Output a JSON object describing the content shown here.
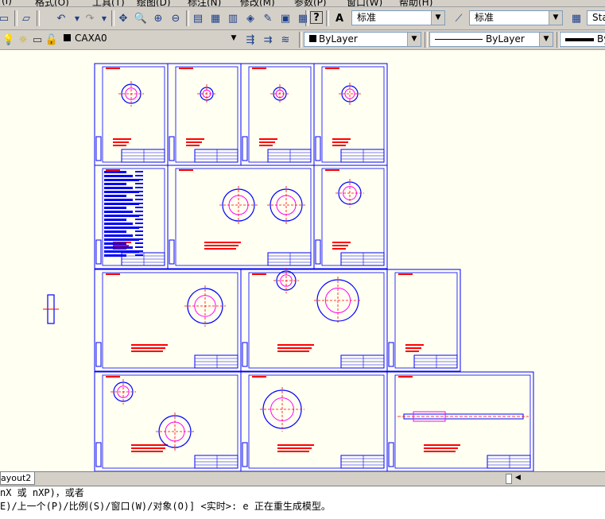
{
  "menubar": {
    "items": [
      "(I)",
      "格式(O)",
      "工具(T)",
      "绘图(D)",
      "标注(N)",
      "修改(M)",
      "参数(P)",
      "窗口(W)",
      "帮助(H)"
    ]
  },
  "toolbar1": {
    "text_style": "标准",
    "dim_style": "标准",
    "table_style": "Sta"
  },
  "toolbar2": {
    "layer": "CAXA0",
    "color": "ByLayer",
    "linetype": "ByLayer",
    "lineweight": "By"
  },
  "tabs": {
    "layout2": "ayout2"
  },
  "command": {
    "line1": "nX 或 nXP)，或者",
    "line2": "E)/上一个(P)/比例(S)/窗口(W)/对象(O)] <实时>: e 正在重生成模型。"
  },
  "colors": {
    "canvas_bg": "#fffff2",
    "sheet_border": "#0000ff",
    "red": "#ff0000",
    "blue": "#0000ff",
    "cyan": "#00a0ff",
    "magenta": "#ff00ff"
  },
  "icons": [
    "undo-icon",
    "redo-icon",
    "zoom-icon",
    "help-icon",
    "layer-icon",
    "bulb-icon",
    "sun-icon",
    "lock-icon"
  ]
}
